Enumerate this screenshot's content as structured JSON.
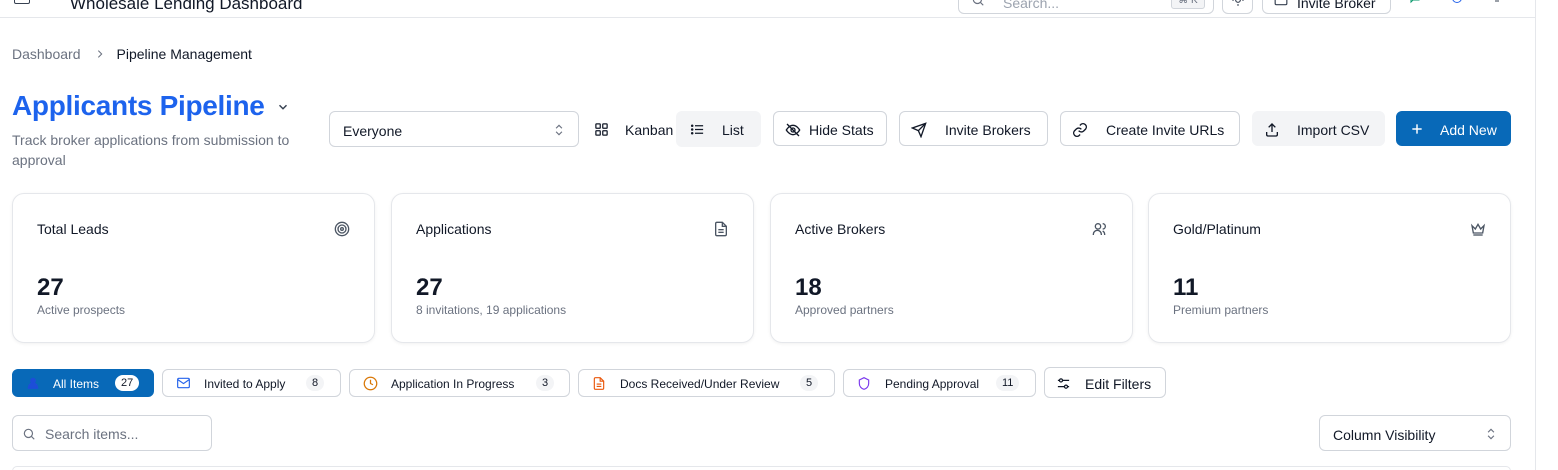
{
  "topbar": {
    "app_title": "Wholesale Lending Dashboard",
    "search_placeholder": "Search...",
    "search_shortcut": "⌘ K",
    "invite_broker_label": "Invite Broker"
  },
  "breadcrumb": {
    "items": [
      "Dashboard",
      "Pipeline Management"
    ]
  },
  "header": {
    "title": "Applicants Pipeline",
    "subtitle": "Track broker applications from submission to approval"
  },
  "owner_select": {
    "value": "Everyone"
  },
  "view_toggle": {
    "kanban": "Kanban",
    "list": "List",
    "active": "list"
  },
  "actions": {
    "hide_stats": "Hide Stats",
    "invite_brokers": "Invite Brokers",
    "create_invite_urls": "Create Invite URLs",
    "import_csv": "Import CSV",
    "add_new": "Add New"
  },
  "stats": [
    {
      "label": "Total Leads",
      "value": "27",
      "sub": "Active prospects",
      "icon": "target-icon"
    },
    {
      "label": "Applications",
      "value": "27",
      "sub": "8 invitations, 19 applications",
      "icon": "document-icon"
    },
    {
      "label": "Active Brokers",
      "value": "18",
      "sub": "Approved partners",
      "icon": "users-icon"
    },
    {
      "label": "Gold/Platinum",
      "value": "11",
      "sub": "Premium partners",
      "icon": "crown-icon"
    }
  ],
  "filters": [
    {
      "label": "All Items",
      "count": "27",
      "icon": "user-icon",
      "active": true
    },
    {
      "label": "Invited to Apply",
      "count": "8",
      "icon": "mail-icon",
      "color": "#2563eb"
    },
    {
      "label": "Application In Progress",
      "count": "3",
      "icon": "clock-icon",
      "color": "#d97706"
    },
    {
      "label": "Docs Received/Under Review",
      "count": "5",
      "icon": "file-icon",
      "color": "#ea580c"
    },
    {
      "label": "Pending Approval",
      "count": "11",
      "icon": "shield-icon",
      "color": "#7c3aed"
    }
  ],
  "edit_filters_label": "Edit Filters",
  "search": {
    "placeholder": "Search items..."
  },
  "column_visibility_label": "Column Visibility",
  "colors": {
    "primary": "#0869b8",
    "title_blue": "#1d63ed",
    "muted_text": "#6b7280",
    "border": "#d1d5db"
  }
}
